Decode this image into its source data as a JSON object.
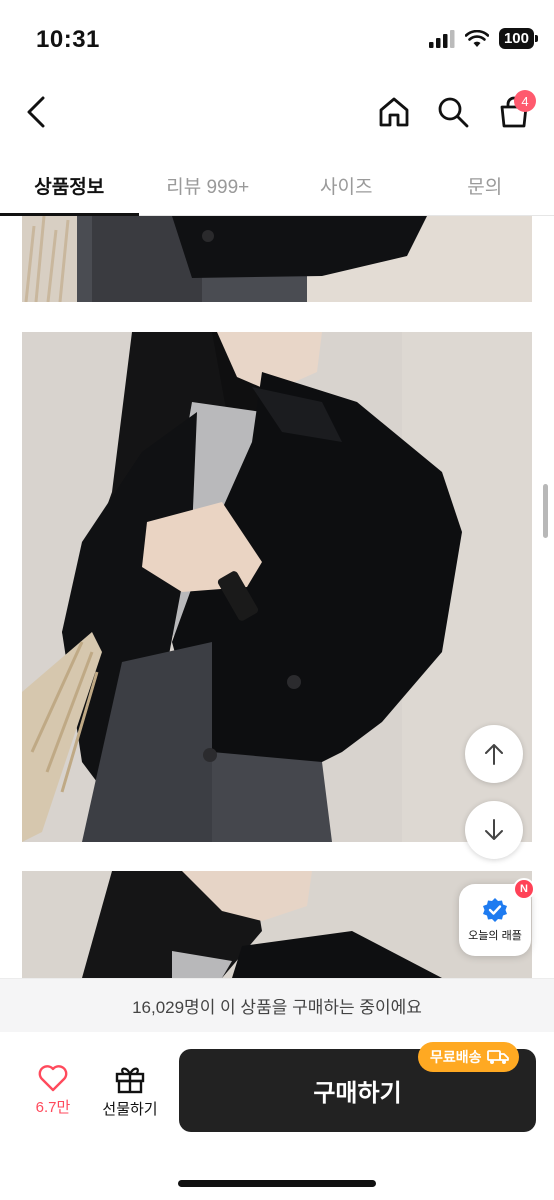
{
  "status_bar": {
    "time": "10:31",
    "battery": "100"
  },
  "nav": {
    "cart_count": "4"
  },
  "tabs": [
    {
      "label": "상품정보",
      "active": true
    },
    {
      "label": "리뷰 999+",
      "active": false
    },
    {
      "label": "사이즈",
      "active": false
    },
    {
      "label": "문의",
      "active": false
    }
  ],
  "raffle": {
    "label": "오늘의 래플",
    "badge": "N"
  },
  "purchase_notice": "16,029명이 이 상품을 구매하는 중이에요",
  "bottom_bar": {
    "like_count": "6.7만",
    "gift_label": "선물하기",
    "buy_label": "구매하기",
    "free_shipping_badge": "무료배송"
  },
  "colors": {
    "accent": "#ff4a5c",
    "buy_button": "#222222",
    "free_shipping": "#ffa922",
    "raffle_check": "#1e7bf0"
  }
}
